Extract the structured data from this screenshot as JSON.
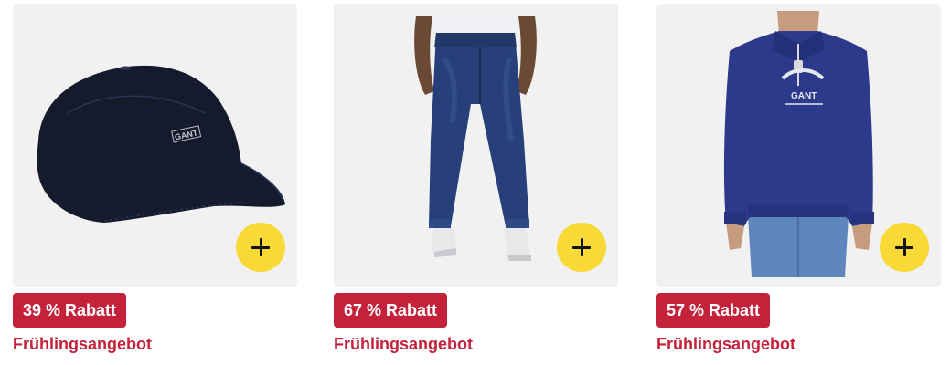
{
  "products": [
    {
      "image": "navy-baseball-cap-image",
      "discount": "39 % Rabatt",
      "deal": "Frühlingsangebot",
      "logo_text": "GANT"
    },
    {
      "image": "blue-jeans-image",
      "discount": "67 % Rabatt",
      "deal": "Frühlingsangebot"
    },
    {
      "image": "navy-half-zip-sweatshirt-image",
      "discount": "57 % Rabatt",
      "deal": "Frühlingsangebot",
      "logo_text": "GANT"
    }
  ],
  "add_icon": "plus-icon",
  "colors": {
    "tile_bg": "#f1f1f2",
    "add_button": "#f8d936",
    "badge": "#c4223b",
    "deal_text": "#c4223b"
  }
}
